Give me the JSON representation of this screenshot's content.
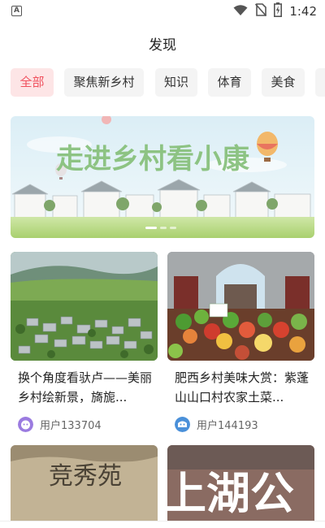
{
  "status_bar": {
    "notification_icon": "a-notification-icon",
    "time": "1:42",
    "icons": [
      "wifi-icon",
      "no-sim-icon",
      "battery-charging-icon"
    ]
  },
  "header": {
    "title": "发现"
  },
  "tabs": [
    {
      "label": "全部",
      "active": true
    },
    {
      "label": "聚焦新乡村",
      "active": false
    },
    {
      "label": "知识",
      "active": false
    },
    {
      "label": "体育",
      "active": false
    },
    {
      "label": "美食",
      "active": false
    }
  ],
  "banner": {
    "text": "走进乡村看小康",
    "page_indicator": {
      "count": 3,
      "active_index": 0
    }
  },
  "cards": [
    {
      "title": "换个角度看驮卢——美丽乡村绘新景，旖旎...",
      "user": "用户133704",
      "avatar_color": "#9b7be0"
    },
    {
      "title": "肥西乡村美味大赏：紫蓬山山口村农家土菜...",
      "user": "用户144193",
      "avatar_color": "#4a90d9"
    }
  ],
  "bottom_cards": [
    {
      "caption": "竞秀苑"
    },
    {
      "caption": "上湖公"
    }
  ],
  "colors": {
    "accent": "#f0505d",
    "accent_bg": "#fde5e6",
    "tab_bg": "#f4f4f4"
  }
}
